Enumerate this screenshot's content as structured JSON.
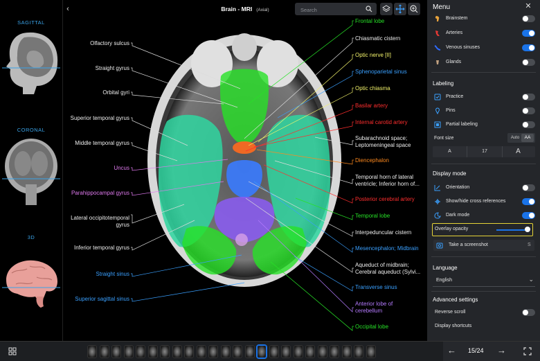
{
  "left_panel": {
    "views": [
      {
        "label": "SAGITTAL"
      },
      {
        "label": "CORONAL"
      },
      {
        "label": "3D"
      }
    ]
  },
  "header": {
    "title": "Brain - MRI",
    "subtitle": "(Axial)",
    "search_placeholder": "Search"
  },
  "labels_left": [
    {
      "text": "Olfactory sulcus",
      "color": "#eeeeee"
    },
    {
      "text": "Straight gyrus",
      "color": "#eeeeee"
    },
    {
      "text": "Orbital gyri",
      "color": "#eeeeee"
    },
    {
      "text": "Superior temporal gyrus",
      "color": "#eeeeee"
    },
    {
      "text": "Middle temporal gyrus",
      "color": "#eeeeee"
    },
    {
      "text": "Uncus",
      "color": "#e07af0"
    },
    {
      "text": "Parahippocampal gyrus",
      "color": "#e07af0"
    },
    {
      "text": "Lateral occipitotemporal",
      "color": "#eeeeee"
    },
    {
      "text": "gyrus",
      "color": "#eeeeee"
    },
    {
      "text": "Inferior temporal gyrus",
      "color": "#eeeeee"
    },
    {
      "text": "Straight sinus",
      "color": "#3aa0ff"
    },
    {
      "text": "Superior sagittal sinus",
      "color": "#3aa0ff"
    }
  ],
  "labels_right": [
    {
      "text": "Frontal lobe",
      "color": "#27e227"
    },
    {
      "text": "Chiasmatic cistern",
      "color": "#eeeeee"
    },
    {
      "text": "Optic nerve [II]",
      "color": "#f3f36b"
    },
    {
      "text": "Sphenoparietal sinus",
      "color": "#3aa0ff"
    },
    {
      "text": "Optic chiasma",
      "color": "#f3f36b"
    },
    {
      "text": "Basilar artery",
      "color": "#ff2e2e"
    },
    {
      "text": "Internal carotid artery",
      "color": "#ff2e2e"
    },
    {
      "text": "Subarachnoid space;",
      "color": "#eeeeee"
    },
    {
      "text": "Leptomeningeal space",
      "color": "#eeeeee"
    },
    {
      "text": "Diencephalon",
      "color": "#ff8a1e"
    },
    {
      "text": "Temporal horn of lateral",
      "color": "#eeeeee"
    },
    {
      "text": "ventricle; Inferior horn of...",
      "color": "#eeeeee"
    },
    {
      "text": "Posterior cerebral artery",
      "color": "#ff2e2e"
    },
    {
      "text": "Temporal lobe",
      "color": "#27e227"
    },
    {
      "text": "Interpeduncular cistern",
      "color": "#eeeeee"
    },
    {
      "text": "Mesencephalon; Midbrain",
      "color": "#3aa0ff"
    },
    {
      "text": "Aqueduct of midbrain;",
      "color": "#eeeeee"
    },
    {
      "text": "Cerebral aqueduct (Sylvi...",
      "color": "#eeeeee"
    },
    {
      "text": "Transverse sinus",
      "color": "#3aa0ff"
    },
    {
      "text": "Anterior lobe of",
      "color": "#b57bff"
    },
    {
      "text": "cerebellum",
      "color": "#b57bff"
    },
    {
      "text": "Occipital lobe",
      "color": "#27e227"
    }
  ],
  "menu": {
    "title": "Menu",
    "structures": [
      {
        "label": "Brainstem",
        "on": false,
        "icon": "brainstem-icon"
      },
      {
        "label": "Arteries",
        "on": true,
        "icon": "arteries-icon"
      },
      {
        "label": "Venous sinuses",
        "on": true,
        "icon": "venous-sinuses-icon"
      },
      {
        "label": "Glands",
        "on": false,
        "icon": "glands-icon"
      }
    ],
    "labeling_title": "Labeling",
    "labeling": [
      {
        "label": "Practice",
        "on": false,
        "icon": "practice-icon"
      },
      {
        "label": "Pins",
        "on": false,
        "icon": "pin-icon"
      },
      {
        "label": "Partial labeling",
        "on": false,
        "icon": "partial-labeling-icon"
      }
    ],
    "font_size": {
      "label": "Font size",
      "auto": "Auto",
      "aa": "AA",
      "small": "A",
      "value": "17",
      "large": "A"
    },
    "display_title": "Display mode",
    "display": [
      {
        "label": "Orientation",
        "on": false,
        "icon": "orientation-icon"
      },
      {
        "label": "Show/hide cross references",
        "on": true,
        "icon": "cross-references-icon"
      },
      {
        "label": "Dark mode",
        "on": true,
        "icon": "dark-mode-icon"
      }
    ],
    "overlay": {
      "label": "Overlay opacity",
      "value": 1.0
    },
    "screenshot": {
      "label": "Take a screenshot",
      "shortcut": "S"
    },
    "language_title": "Language",
    "language_value": "English",
    "advanced_title": "Advanced settings",
    "reverse_scroll": {
      "label": "Reverse scroll",
      "on": false
    },
    "display_shortcuts": "Display shortcuts"
  },
  "footer": {
    "page_indicator": "15/24",
    "current_slice": 15,
    "total_slices": 24
  },
  "colors": {
    "accent": "#1a73e8",
    "frontal_lobe": "#27e227",
    "temporal_lobe": "#2fd6a0",
    "midbrain": "#3a7bff",
    "cerebellum": "#8b5cf6",
    "diencephalon": "#ff6a1e"
  }
}
